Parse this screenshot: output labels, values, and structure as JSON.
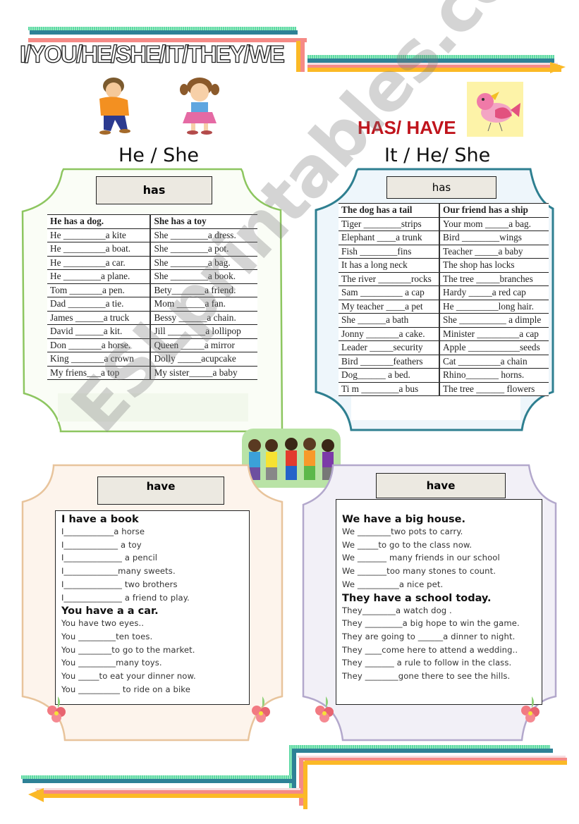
{
  "title": "I/YOU/HE/SHE/IT/THEY/WE",
  "heading": "HAS/ HAVE",
  "watermark": "ESLprintables.com",
  "colors": {
    "heading_red": "#c0141c",
    "panel_green": "#8dc660",
    "panel_teal": "#2e7f90",
    "panel_peach": "#e8c49c",
    "panel_lavender": "#b3a8cc",
    "label_bg": "#ece9e1"
  },
  "images": {
    "boy": "boy-dancing-illustration",
    "girl": "girl-cheerful-illustration",
    "bird": "pink-bird-illustration",
    "kids": "group-of-kids-illustration",
    "flower": "pink-flower-decoration"
  },
  "panels": {
    "top_left": {
      "subhead": "He / She",
      "label": "has",
      "header": [
        "He has a dog.",
        "She has a toy"
      ],
      "rows": [
        [
          "He _________a kite",
          "She ________a dress."
        ],
        [
          "He _________a boat.",
          "She ________a pot."
        ],
        [
          "He _________a car.",
          "She ________a bag."
        ],
        [
          "He ________a plane.",
          "She ________a book."
        ],
        [
          "Tom _______a pen.",
          "Bety_______a friend."
        ],
        [
          "Dad ________a tie.",
          "Mom ______a fan."
        ],
        [
          "James ______a truck",
          "Bessy ______a chain."
        ],
        [
          "David ______a kit.",
          "Jill ________a lollipop"
        ],
        [
          "Don _______a horse.",
          "Queen _____a mirror"
        ],
        [
          "King _______a crown",
          "Dolly _____acupcake"
        ],
        [
          "My friens___a top",
          "My sister_____a baby"
        ]
      ]
    },
    "top_right": {
      "subhead": "It / He/ She",
      "label": "has",
      "header": [
        "The dog has a tail",
        "Our friend has a ship"
      ],
      "rows": [
        [
          "Tiger ________strips",
          "Your  mom _____a bag."
        ],
        [
          "Elephant ____a trunk",
          "Bird ________wings"
        ],
        [
          "Fish ________fins",
          "Teacher _____a baby"
        ],
        [
          "It  has a long neck",
          "The  shop has locks"
        ],
        [
          "The river _______rocks",
          "The tree _____branches"
        ],
        [
          "Sam _________ a cap",
          "Hardy _____a red cap"
        ],
        [
          "My teacher ____a pet",
          "He _________long hair."
        ],
        [
          "She ______a bath",
          "She __________ a dimple"
        ],
        [
          "Jonny _______a cake.",
          "Minister _________a cap"
        ],
        [
          "Leader _____security",
          "Apple ___________seeds"
        ],
        [
          "Bird _______feathers",
          "Cat _________a chain"
        ],
        [
          "Dog______ a bed.",
          "Rhino_______ horns."
        ],
        [
          "Ti m ________a bus",
          "The tree ______ flowers"
        ]
      ]
    },
    "bottom_left": {
      "label": "have",
      "sections": [
        {
          "heading": "I have a book",
          "lines": [
            "I____________a horse",
            "I_____________ a toy",
            "I______________ a pencil",
            "I_____________many sweets.",
            "I______________ two brothers",
            " I______________ a friend  to play."
          ]
        },
        {
          "heading": "You  have a a car.",
          "lines": [
            "You have two eyes..",
            "You _________ten toes.",
            "You ________to go to the market.",
            "You _________many toys.",
            "You _____to eat your dinner now.",
            "You __________ to ride on a bike"
          ]
        }
      ]
    },
    "bottom_right": {
      "label": "have",
      "sections": [
        {
          "heading": "We have a big house.",
          "lines": [
            "We ________two pots to carry.",
            "We _____to go to the class now.",
            "We _______ many friends in our school",
            "We _______too many stones to count.",
            "We __________a nice pet."
          ]
        },
        {
          "heading": "They have a school today.",
          "lines": [
            "They________a watch dog .",
            "They _________a big hope to  win the game.",
            "They are going to ______a dinner to night.",
            "They ____come here to attend a wedding..",
            "They  _______ a rule to follow in the class.",
            "They ________gone there to see the hills."
          ]
        }
      ]
    }
  }
}
